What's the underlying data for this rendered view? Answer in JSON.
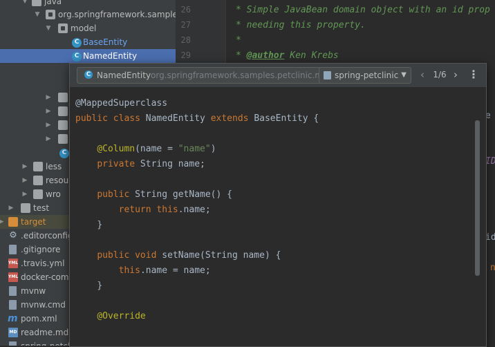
{
  "tree": {
    "items": [
      {
        "label": "java",
        "icon": "folder-icon",
        "arrow": "expanded",
        "indent": 1
      },
      {
        "label": "org.springframework.samples.pe",
        "icon": "package-icon",
        "arrow": "expanded",
        "indent": 2
      },
      {
        "label": "model",
        "icon": "package-icon",
        "arrow": "expanded",
        "indent": 3
      },
      {
        "label": "BaseEntity",
        "icon": "class-icon",
        "arrow": "",
        "indent": 4
      },
      {
        "label": "NamedEntity",
        "icon": "class-icon",
        "arrow": "",
        "indent": 4,
        "selected": true
      },
      {
        "label": "less",
        "icon": "folder-icon",
        "arrow": "collapsed"
      },
      {
        "label": "resour",
        "icon": "folder-icon",
        "arrow": "collapsed"
      },
      {
        "label": "wro",
        "icon": "folder-icon",
        "arrow": "collapsed"
      },
      {
        "label": "test",
        "icon": "folder-icon",
        "arrow": "collapsed"
      },
      {
        "label": "target",
        "icon": "folder-icon",
        "arrow": "collapsed"
      },
      {
        "label": ".editorconfig",
        "icon": "gear-icon"
      },
      {
        "label": ".gitignore",
        "icon": "file-icon"
      },
      {
        "label": ".travis.yml",
        "icon": "yml-icon"
      },
      {
        "label": "docker-comp",
        "icon": "yml-icon"
      },
      {
        "label": "mvnw",
        "icon": "file-icon"
      },
      {
        "label": "mvnw.cmd",
        "icon": "file-icon"
      },
      {
        "label": "pom.xml",
        "icon": "maven-icon"
      },
      {
        "label": "readme.md",
        "icon": "md-icon"
      },
      {
        "label": "spring-petclinic.iml",
        "icon": "file-icon"
      }
    ]
  },
  "gutter": {
    "line_numbers": [
      "26",
      "27",
      "28",
      "29"
    ]
  },
  "editor": {
    "lines": [
      "* Simple JavaBean domain object with an id prop",
      "* needing this property.",
      "*",
      "* @author Ken Krebs"
    ],
    "author_tag": "@author",
    "author_name": " Ken Krebs",
    "fragments": [
      "e",
      "ID",
      "id",
      "n"
    ]
  },
  "popup": {
    "class_name": "NamedEntity",
    "package": "org.springframework.samples.petclinic.model",
    "module": "spring-petclinic",
    "page_counter": "1/6",
    "prev_icon": "chevron-left-icon",
    "next_icon": "chevron-right-icon",
    "menu_icon": "more-vertical-icon",
    "code": {
      "annotation": "@MappedSuperclass",
      "l_public": "public",
      "l_class": "class",
      "l_name": "NamedEntity",
      "l_extends": "extends",
      "l_base": "BaseEntity {",
      "col_ann": "@Column",
      "col_open": "(name = ",
      "col_str": "\"name\"",
      "col_close": ")",
      "priv": "private",
      "priv_rest": " String name;",
      "get_pub": "public",
      "get_rest": " String getName() {",
      "ret_kw": "return",
      "this_kw": "this",
      "ret_rest": ".name;",
      "close1": "}",
      "set_pub": "public",
      "set_void": "void",
      "set_rest": " setName(String name) {",
      "this2": "this",
      "set_body": ".name = name;",
      "close2": "}",
      "override": "@Override"
    }
  },
  "colors": {
    "tree_bg": "#3c3f41",
    "selection": "#4b6eaf",
    "editor_bg": "#2b2b2b",
    "keyword": "#cc7832",
    "annotation": "#bbb529",
    "string": "#6a8759",
    "comment": "#629755"
  }
}
